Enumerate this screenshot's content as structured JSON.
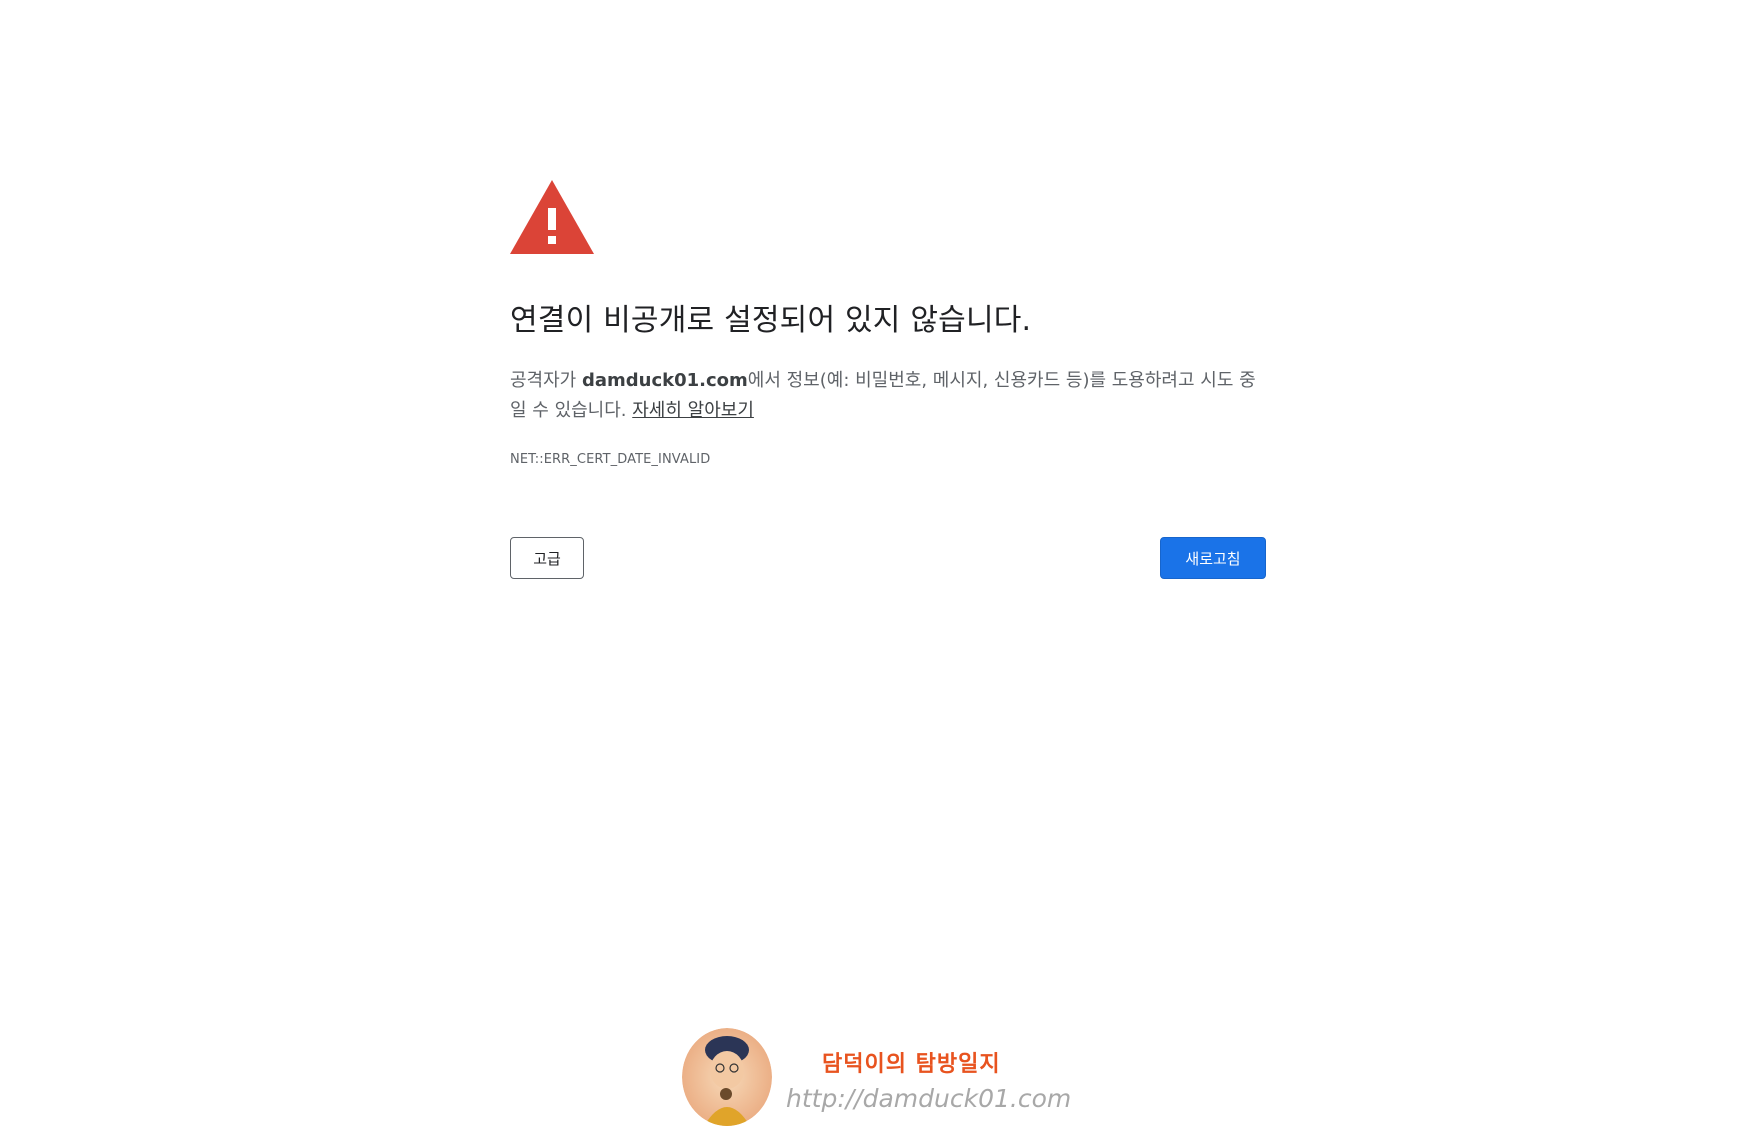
{
  "interstitial": {
    "headline": "연결이 비공개로 설정되어 있지 않습니다.",
    "explanation_prefix": "공격자가 ",
    "domain": "damduck01.com",
    "explanation_suffix": "에서 정보(예: 비밀번호, 메시지, 신용카드 등)를 도용하려고 시도 중일 수 있습니다. ",
    "learn_more": "자세히 알아보기",
    "error_code": "NET::ERR_CERT_DATE_INVALID",
    "advanced_button": "고급",
    "reload_button": "새로고침",
    "icon": "warning-triangle-icon",
    "colors": {
      "warning_red": "#db4437",
      "primary_blue": "#1a73e8",
      "text_primary": "#202124",
      "text_secondary": "#5f6368"
    }
  },
  "watermark": {
    "title": "담덕이의 탐방일지",
    "url": "http://damduck01.com",
    "title_color": "#e8531f",
    "url_color": "#a8a8a8"
  }
}
